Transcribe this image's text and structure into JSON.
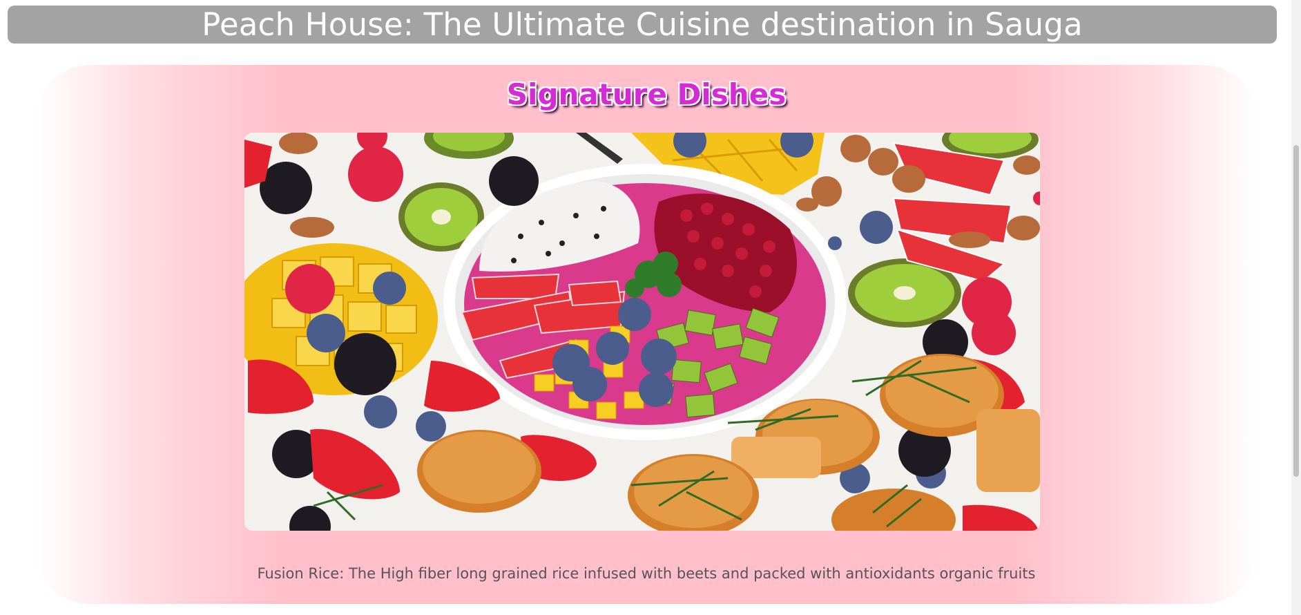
{
  "header": {
    "title": "Peach House: The Ultimate Cuisine destination in Sauga"
  },
  "signature": {
    "title": "Signature Dishes",
    "image_alt": "Fruit bowl with dragon fruit, coconut, pomegranate, kiwi, strawberries, blueberries, mango and muffins",
    "caption": "Fusion Rice: The High fiber long grained rice infused with beets and packed with antioxidants organic fruits"
  },
  "colors": {
    "header_bg": "#a3a3a3",
    "card_pink": "#ffc0cb",
    "title_magenta": "#d52bd4",
    "caption_text": "#555555"
  }
}
